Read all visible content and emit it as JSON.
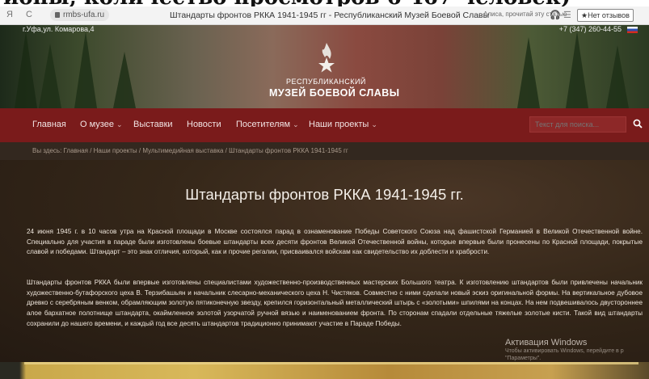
{
  "caption": "ионы, количество просмотров 6 467 человек)",
  "browser": {
    "nav_back": "Я",
    "nav_reload": "C",
    "url": "rmbs-ufa.ru",
    "title": "Штандарты фронтов РККА 1941-1945 гг - Республиканский Музей Боевой Славы",
    "alisa": "Алиса, прочитай эту статью",
    "reviews": "★Нет отзывов"
  },
  "header": {
    "address": "г.Уфа,ул. Комарова,4",
    "phone": "+7 (347) 260-44-55",
    "logo_line1": "РЕСПУБЛИКАНСКИЙ",
    "logo_line2": "МУЗЕЙ БОЕВОЙ СЛАВЫ"
  },
  "nav": {
    "items": [
      {
        "label": "Главная",
        "dropdown": false
      },
      {
        "label": "О музее",
        "dropdown": true
      },
      {
        "label": "Выставки",
        "dropdown": false
      },
      {
        "label": "Новости",
        "dropdown": false
      },
      {
        "label": "Посетителям",
        "dropdown": true
      },
      {
        "label": "Наши проекты",
        "dropdown": true
      }
    ],
    "search_placeholder": "Текст для поиска..."
  },
  "breadcrumb": "Вы здесь: Главная / Наши проекты / Мультимедийная выставка / Штандарты фронтов РККА 1941-1945 гг",
  "page": {
    "title": "Штандарты фронтов РККА 1941-1945 гг.",
    "para1": "24 июня 1945 г. в 10 часов утра на Красной площади в Москве состоялся парад в ознаменование Победы Советского Союза над фашистской Германией в Великой Отечественной войне. Специально для участия в параде были изготовлены боевые штандарты всех десяти фронтов Великой Отечественной войны, которые впервые были пронесены по Красной площади, покрытые славой и победами. Штандарт – это знак отличия, который, как и прочие регалии, присваивался войскам как свидетельство их доблести и храбрости.",
    "para2": "Штандарты фронтов РККА были впервые изготовлены специалистами художественно-производственных мастерских Большого театра. К изготовлению штандартов были привлечены начальник художественно-бутафорского цеха В. Терзибашьян и начальник слесарно-механического цеха Н. Чистяков. Совместно с ними сделали новый эскиз оригинальной формы. На вертикальное дубовое древко с серебряным венком, обрамляющим золотую пятиконечную звезду, крепился горизонтальный металлический штырь с «золотыми» шпилями на концах. На нем подвешивалось двустороннее алое бархатное полотнище штандарта, окаймленное золотой узорчатой ручной вязью и наименованием фронта. По сторонам спадали отдельные тяжелые золотые кисти. Такой вид штандарты сохранили до нашего времени, и каждый год все десять штандартов традиционно принимают участие в Параде Победы."
  },
  "windows": {
    "line1": "Активация Windows",
    "line2": "Чтобы активировать Windows, перейдите в р",
    "line3": "\"Параметры\"."
  },
  "colors": {
    "nav_bg": "#7a1b1b",
    "content_bg": "#352719",
    "accent_flag": "#d52b1e"
  }
}
